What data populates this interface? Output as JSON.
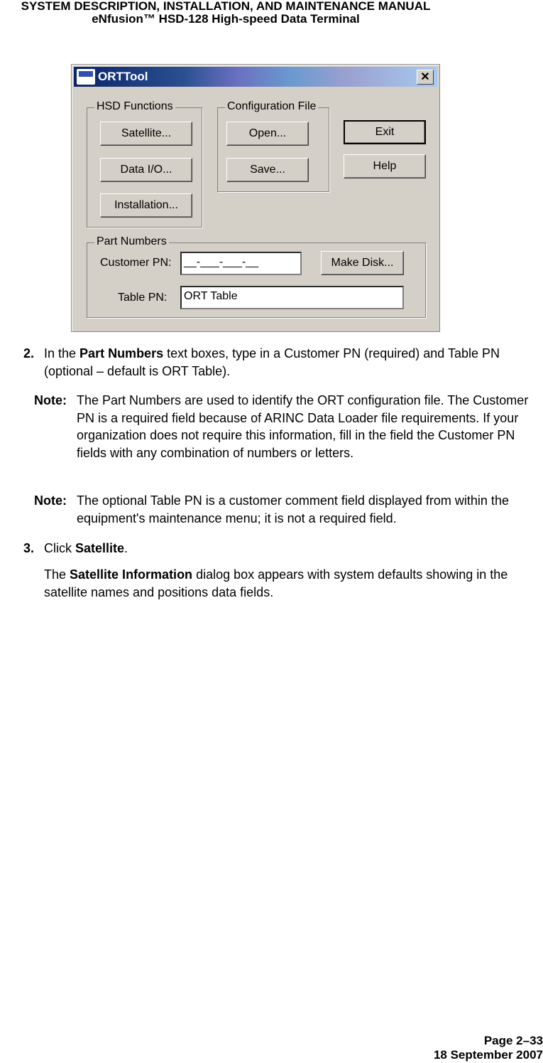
{
  "header": {
    "line1": "SYSTEM DESCRIPTION, INSTALLATION, AND MAINTENANCE MANUAL",
    "line2": "eNfusion™ HSD-128 High-speed Data Terminal"
  },
  "dialog": {
    "title": "ORTTool",
    "close_label": "✕",
    "hsd_group": "HSD Functions",
    "satellite": "Satellite...",
    "data_io": "Data I/O...",
    "installation": "Installation...",
    "config_group": "Configuration File",
    "open": "Open...",
    "save": "Save...",
    "exit": "Exit",
    "help": "Help",
    "pn_group": "Part Numbers",
    "customer_pn_label": "Customer PN:",
    "customer_pn_value": "__-___-___-__",
    "make_disk": "Make Disk...",
    "table_pn_label": "Table PN:",
    "table_pn_value": "ORT Table"
  },
  "step2": {
    "num": "2.",
    "pre": "In the ",
    "bold": "Part Numbers",
    "post": " text boxes, type in a Customer PN (required) and Table PN (optional – default is ORT Table)."
  },
  "note1": {
    "label": "Note:",
    "text": "The Part Numbers are used to identify the ORT configuration file. The Customer PN is a required field because of ARINC Data Loader file requirements. If your organization does not require this information, fill in the field the Customer PN fields with any combination of numbers or letters."
  },
  "note2": {
    "label": "Note:",
    "text": "The optional Table PN is a customer comment field displayed from within the equipment's maintenance menu; it is not a required field."
  },
  "step3": {
    "num": "3.",
    "pre": "Click ",
    "bold": "Satellite",
    "post": "."
  },
  "para": {
    "pre": "The ",
    "bold": "Satellite Information",
    "post": " dialog box appears with system defaults showing in the satellite names and positions data fields."
  },
  "footer": {
    "page": "Page 2–33",
    "date": "18 September 2007"
  }
}
